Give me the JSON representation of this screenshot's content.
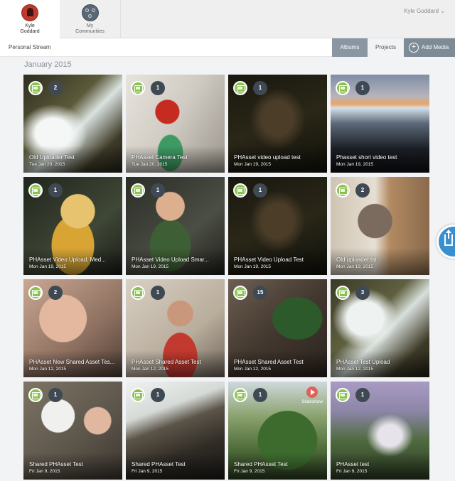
{
  "account_tabs": [
    {
      "name": "Kyle",
      "subtitle": "Goddard"
    },
    {
      "name": "My",
      "subtitle": "Communities"
    }
  ],
  "user_menu": "Kyle Goddard ⌄",
  "stream_label": "Personal Stream",
  "nav": {
    "albums": "Albums",
    "projects": "Projects",
    "add_media": "Add Media"
  },
  "month": "January 2015",
  "cards": [
    {
      "title": "Old Uploader Test",
      "date": "Tue Jan 20, 2015",
      "count": "2"
    },
    {
      "title": "PHAsset Camera Test",
      "date": "Tue Jan 20, 2015",
      "count": "1"
    },
    {
      "title": "PHAsset video upload test",
      "date": "Mon Jan 19, 2015",
      "count": "1"
    },
    {
      "title": "Phasset short video test",
      "date": "Mon Jan 19, 2015",
      "count": "1"
    },
    {
      "title": "PHAsset Video Upload, Med...",
      "date": "Mon Jan 19, 2015",
      "count": "1"
    },
    {
      "title": "PHAsset Video Upload Smar...",
      "date": "Mon Jan 19, 2015",
      "count": "1"
    },
    {
      "title": "PHAsset Video Upload Test",
      "date": "Mon Jan 19, 2015",
      "count": "1"
    },
    {
      "title": "Old uploader tst",
      "date": "Mon Jan 19, 2015",
      "count": "2"
    },
    {
      "title": "PHAsset New Shared Asset Tes...",
      "date": "Mon Jan 12, 2015",
      "count": "2"
    },
    {
      "title": "PHAsset Shared Asset Test",
      "date": "Mon Jan 12, 2015",
      "count": "1"
    },
    {
      "title": "PHAsset Shared Asset Test",
      "date": "Mon Jan 12, 2015",
      "count": "15"
    },
    {
      "title": "PHAsset Test Upload",
      "date": "Mon Jan 12, 2015",
      "count": "3"
    },
    {
      "title": "Shared PHAsset Test",
      "date": "Fri Jan 9, 2015",
      "count": "1"
    },
    {
      "title": "Shared PHAsset Test",
      "date": "Fri Jan 9, 2015",
      "count": "1"
    },
    {
      "title": "Shared PHAsset Test",
      "date": "Fri Jan 9, 2015",
      "count": "1"
    },
    {
      "title": "PHAsset test",
      "date": "Fri Jan 9, 2015",
      "count": "1"
    }
  ],
  "slideshow_label": "Slideshow",
  "colors": {
    "album_green": "#8cc152",
    "badge_dark": "#3f4953",
    "share_blue": "#3a8fd0",
    "slideshow_red": "#e0605a"
  }
}
